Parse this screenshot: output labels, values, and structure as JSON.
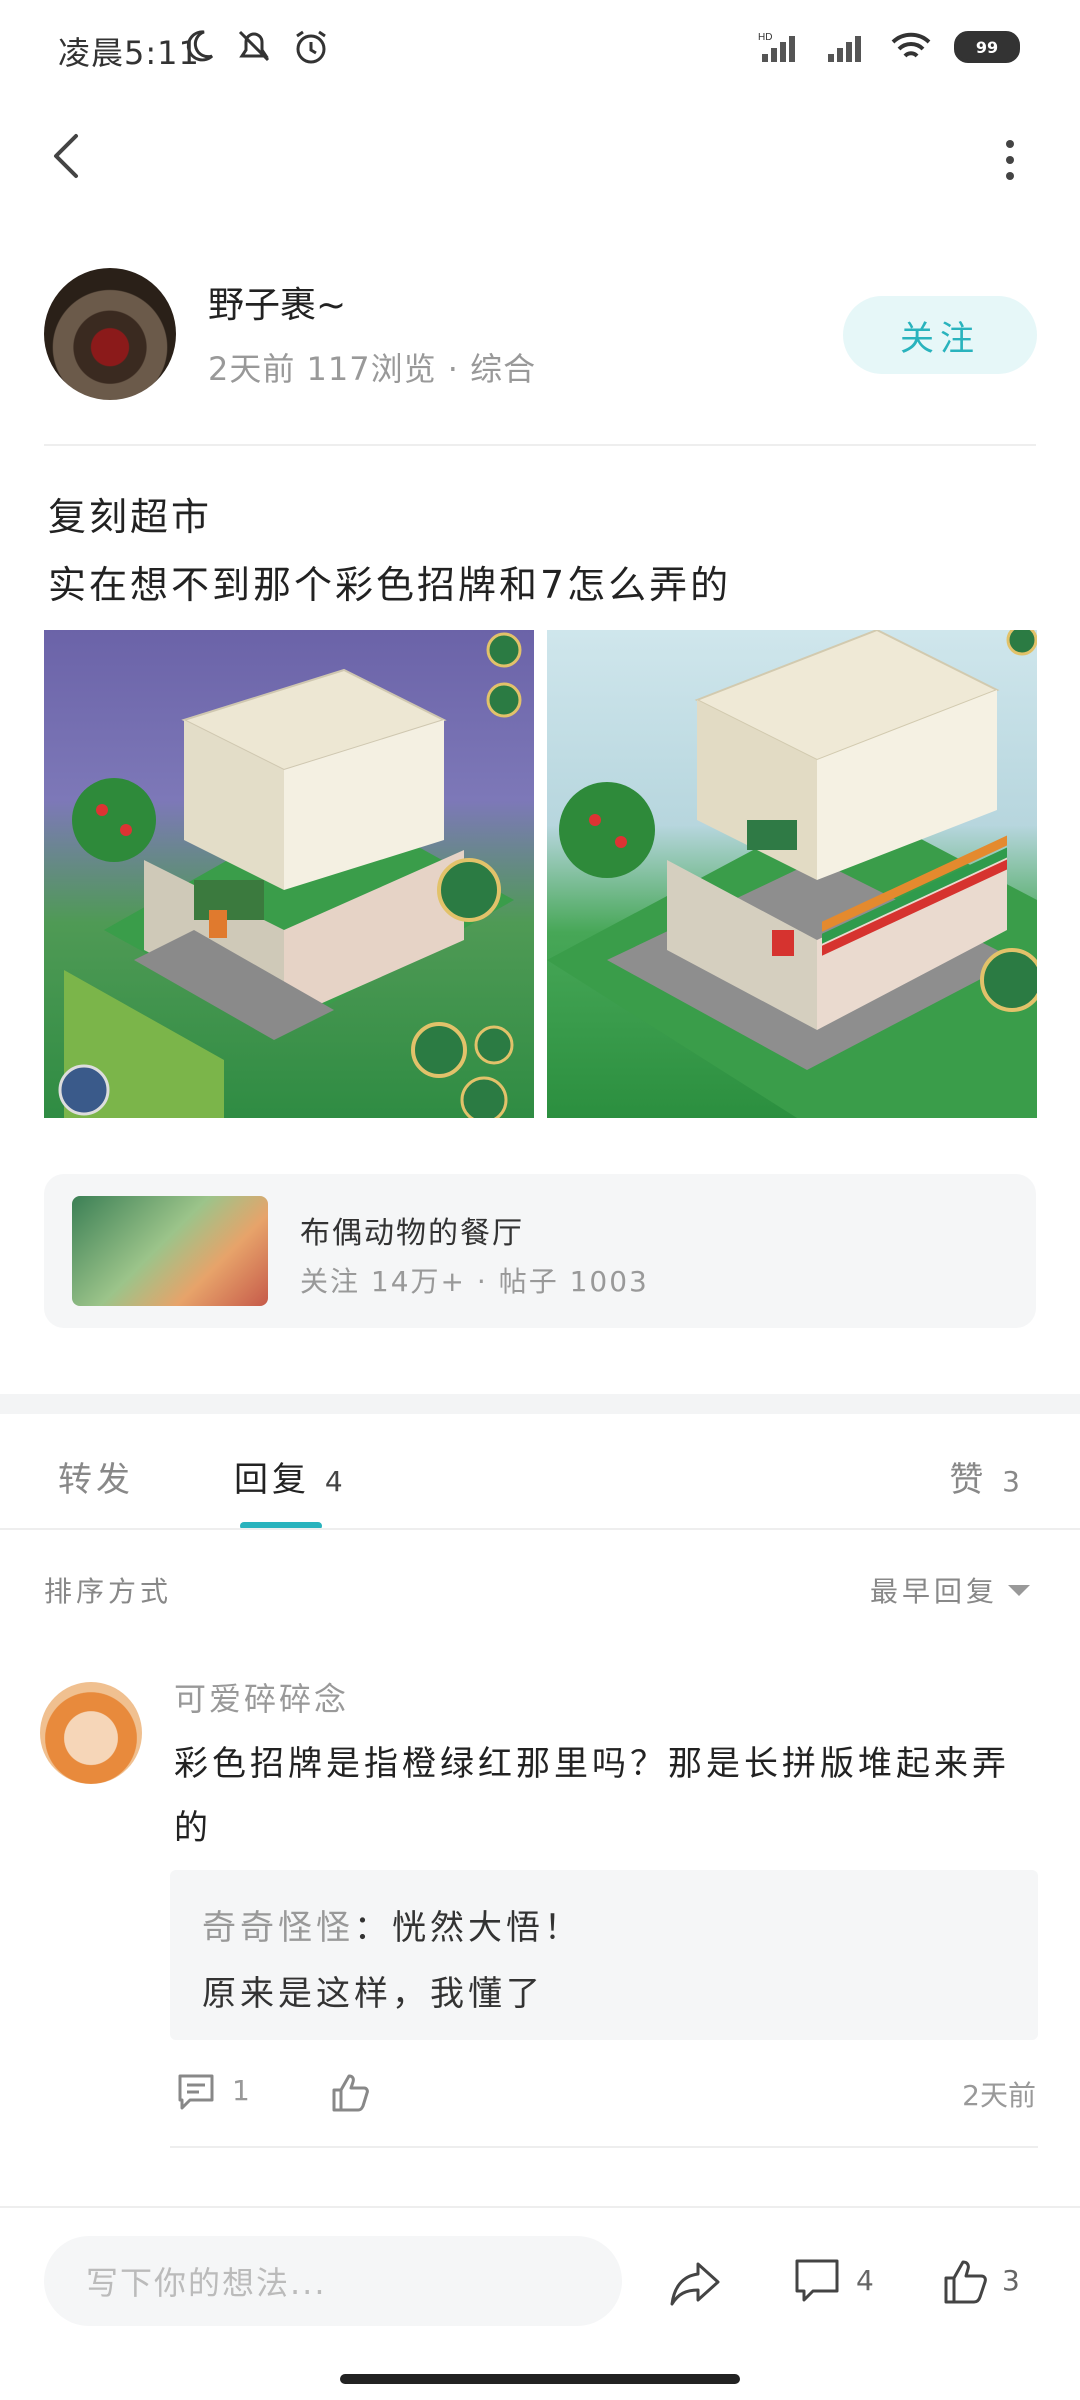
{
  "status_bar": {
    "time": "凌晨5:11",
    "battery": "99"
  },
  "author": {
    "name": "野子裹~",
    "meta": "2天前  117浏览 · 综合",
    "follow_label": "关注"
  },
  "post": {
    "line1": "复刻超市",
    "line2": "实在想不到那个彩色招牌和7怎么弄的"
  },
  "community": {
    "name": "布偶动物的餐厅",
    "meta": "关注 14万+ · 帖子 1003"
  },
  "tabs": {
    "forward": "转发",
    "reply": "回复",
    "reply_count": "4",
    "like": "赞",
    "like_count": "3"
  },
  "sort": {
    "label": "排序方式",
    "value": "最早回复"
  },
  "comment": {
    "author": "可爱碎碎念",
    "text_line1": "彩色招牌是指橙绿红那里吗？那是长拼版堆起来弄",
    "text_line2": "的",
    "reply": {
      "author": "奇奇怪怪",
      "separator": "：",
      "text1": "恍然大悟！",
      "text2": "原来是这样，我懂了"
    },
    "reply_count": "1",
    "time": "2天前"
  },
  "bottom_bar": {
    "input_placeholder": "写下你的想法...",
    "comment_count": "4",
    "like_count": "3"
  },
  "colors": {
    "accent": "#29b3bd",
    "follow_bg": "#e6f7f8"
  }
}
